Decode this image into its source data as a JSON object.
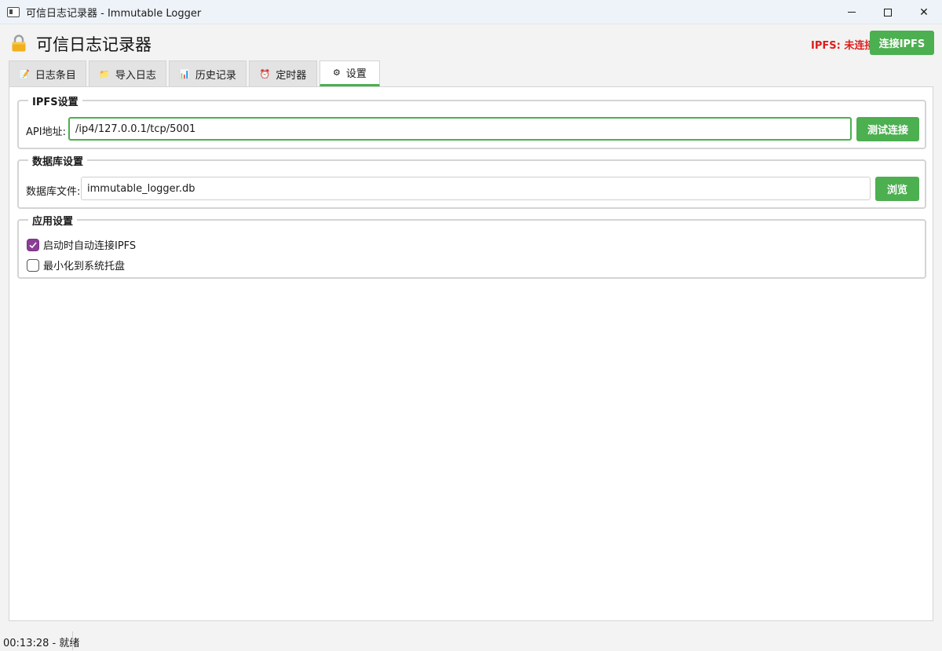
{
  "window": {
    "title": "可信日志记录器 - Immutable Logger",
    "controls": {
      "minimize": "minimize",
      "maximize": "maximize",
      "close": "✕"
    }
  },
  "header": {
    "app_title": "可信日志记录器",
    "ipfs_status": "IPFS: 未连接",
    "connect_button": "连接IPFS"
  },
  "tabs": [
    {
      "label": "日志条目",
      "icon": "memo-icon"
    },
    {
      "label": "导入日志",
      "icon": "folder-icon"
    },
    {
      "label": "历史记录",
      "icon": "bar-chart-icon"
    },
    {
      "label": "定时器",
      "icon": "alarm-clock-icon"
    },
    {
      "label": "设置",
      "icon": "gear-icon",
      "active": true
    }
  ],
  "settings": {
    "ipfs": {
      "title": "IPFS设置",
      "api_label": "API地址:",
      "api_value": "/ip4/127.0.0.1/tcp/5001",
      "test_button": "测试连接"
    },
    "database": {
      "title": "数据库设置",
      "file_label": "数据库文件:",
      "file_value": "immutable_logger.db",
      "browse_button": "浏览"
    },
    "app": {
      "title": "应用设置",
      "auto_connect": {
        "label": "启动时自动连接IPFS",
        "checked": true
      },
      "minimize_tray": {
        "label": "最小化到系统托盘",
        "checked": false
      }
    }
  },
  "statusbar": {
    "text": "00:13:28 - 就绪"
  },
  "colors": {
    "accent": "#4caf50",
    "error": "#e01b1b",
    "checkbox": "#8a3f95"
  }
}
